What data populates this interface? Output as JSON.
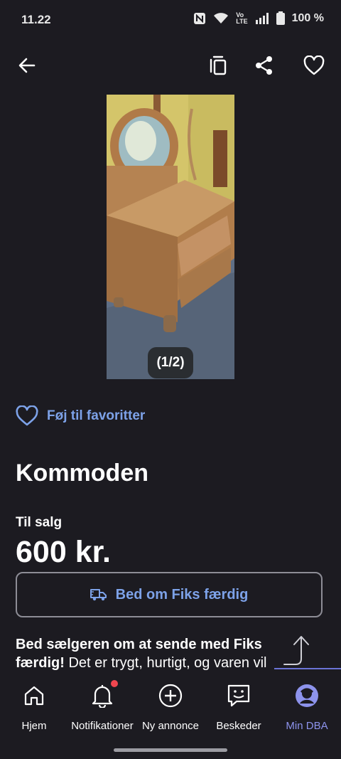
{
  "status_bar": {
    "time": "11.22",
    "battery": "100 %",
    "volte": "Vo",
    "lte": "LTE"
  },
  "toolbar": {
    "icons": [
      "back-arrow-icon",
      "copy-icon",
      "share-icon",
      "heart-icon"
    ]
  },
  "listing": {
    "photo_counter": "(1/2)",
    "favorite_label": "Føj til favoritter",
    "title": "Kommoden",
    "sale_type": "Til salg",
    "price": "600 kr.",
    "fiks_button": "Bed om Fiks færdig",
    "description_bold": "Bed sælgeren om at sende med Fiks færdig!",
    "description_rest": " Det er trygt, hurtigt, og varen vil"
  },
  "bottom_nav": {
    "items": [
      {
        "label": "Hjem",
        "icon": "home-icon"
      },
      {
        "label": "Notifikationer",
        "icon": "bell-icon"
      },
      {
        "label": "Ny annonce",
        "icon": "plus-circle-icon"
      },
      {
        "label": "Beskeder",
        "icon": "chat-icon"
      },
      {
        "label": "Min DBA",
        "icon": "profile-icon"
      }
    ],
    "active_index": 4
  },
  "colors": {
    "background": "#1c1b21",
    "link_blue": "#7da2e8",
    "active_nav": "#8d93ec",
    "notification_dot": "#f0464f"
  }
}
